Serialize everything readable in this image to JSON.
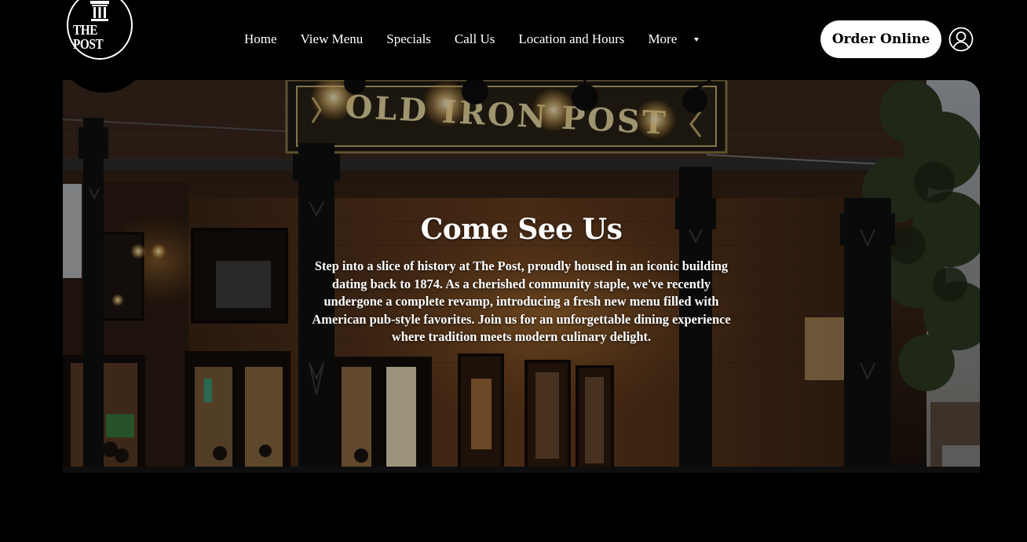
{
  "brand": {
    "logo_text": "THE POST",
    "icon": "pillar-icon"
  },
  "nav": {
    "items": [
      {
        "label": "Home"
      },
      {
        "label": "View Menu"
      },
      {
        "label": "Specials"
      },
      {
        "label": "Call Us"
      },
      {
        "label": "Location and Hours"
      }
    ],
    "more_label": "More",
    "more_icon": "caret-down-icon"
  },
  "header": {
    "order_label": "Order Online",
    "account_icon": "user-account-icon"
  },
  "hero": {
    "sign_text": "OLD IRON POST",
    "title": "Come See Us",
    "body": "Step into a slice of history at The Post, proudly housed in an iconic building dating back to 1874. As a cherished community staple, we've recently undergone a complete revamp, introducing a fresh new menu filled with American pub-style favorites. Join us for an unforgettable dining experience where tradition meets modern culinary delight."
  },
  "colors": {
    "background": "#000000",
    "text": "#ffffff",
    "button_bg": "#ffffff",
    "button_text": "#000000"
  }
}
